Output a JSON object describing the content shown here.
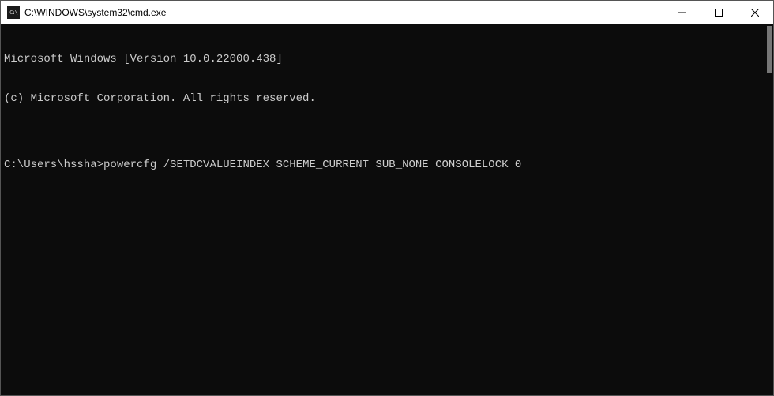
{
  "titlebar": {
    "icon_label": "C:\\",
    "title": "C:\\WINDOWS\\system32\\cmd.exe"
  },
  "console": {
    "line1": "Microsoft Windows [Version 10.0.22000.438]",
    "line2": "(c) Microsoft Corporation. All rights reserved.",
    "blank": "",
    "prompt": "C:\\Users\\hssha>",
    "command": "powercfg /SETDCVALUEINDEX SCHEME_CURRENT SUB_NONE CONSOLELOCK 0"
  }
}
